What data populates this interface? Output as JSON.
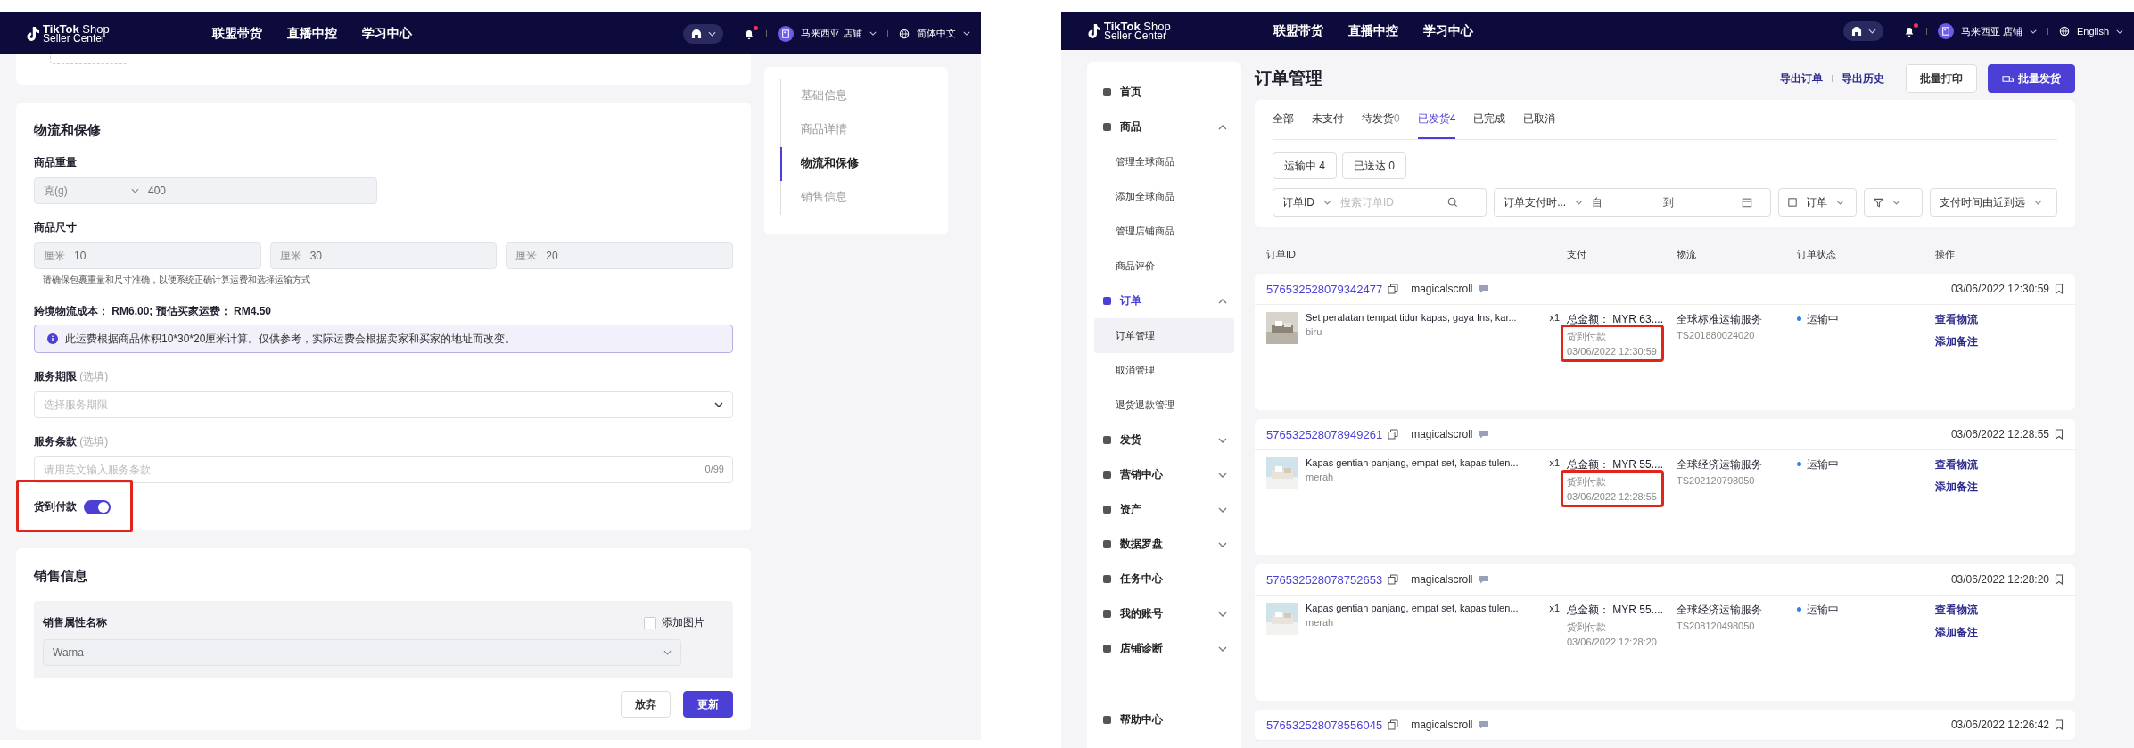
{
  "editor": {
    "nav": {
      "brand": "**TikTok** Shop",
      "brand_sub": "Seller Center",
      "links": [
        "联盟带货",
        "直播中控",
        "学习中心"
      ],
      "has_notification": true,
      "shop": "马来西亚 店铺",
      "language": "简体中文"
    },
    "logistics": {
      "title": "物流和保修",
      "weight": {
        "label": "商品重量",
        "unit": "克(g)",
        "value": "400"
      },
      "size": {
        "label": "商品尺寸",
        "fields": [
          {
            "unit": "厘米",
            "value": "10"
          },
          {
            "unit": "厘米",
            "value": "30"
          },
          {
            "unit": "厘米",
            "value": "20"
          }
        ],
        "hint": "请确保包裹重量和尺寸准确，以便系统正确计算运费和选择运输方式"
      },
      "cost": "跨境物流成本： RM6.00; 预估买家运费： RM4.50",
      "info": "此运费根据商品体积10*30*20厘米计算。仅供参考，实际运费会根据卖家和买家的地址而改变。",
      "service_period": {
        "label": "服务期限",
        "optional": "(选填)",
        "placeholder": "选择服务期限"
      },
      "service_terms": {
        "label": "服务条款",
        "optional": "(选填)",
        "placeholder": "请用英文输入服务条款",
        "counter": "0/99"
      },
      "cod": {
        "label": "货到付款",
        "on": true,
        "highlighted": true
      }
    },
    "sales": {
      "title": "销售信息",
      "attr_label": "销售属性名称",
      "add_image": {
        "label": "添加图片",
        "checked": false
      },
      "attr_value": "Warna",
      "discard": "放弃",
      "update": "更新"
    },
    "anchors": [
      {
        "label": "基础信息",
        "selected": false
      },
      {
        "label": "商品详情",
        "selected": false
      },
      {
        "label": "物流和保修",
        "selected": true
      },
      {
        "label": "销售信息",
        "selected": false
      }
    ]
  },
  "orders": {
    "nav": {
      "brand": "**TikTok** Shop",
      "brand_sub": "Seller Center",
      "links": [
        "联盟带货",
        "直播中控",
        "学习中心"
      ],
      "has_notification": true,
      "shop": "马来西亚 店铺",
      "language": "English"
    },
    "sidebar": [
      {
        "label": "首页",
        "kind": "link",
        "selected": false
      },
      {
        "label": "商品",
        "kind": "group",
        "expanded": true,
        "selected": false,
        "children": [
          {
            "label": "管理全球商品",
            "selected": false
          },
          {
            "label": "添加全球商品",
            "selected": false
          },
          {
            "label": "管理店铺商品",
            "selected": false
          },
          {
            "label": "商品评价",
            "selected": false
          }
        ]
      },
      {
        "label": "订单",
        "kind": "group",
        "expanded": true,
        "selected": true,
        "children": [
          {
            "label": "订单管理",
            "selected": true
          },
          {
            "label": "取消管理",
            "selected": false
          },
          {
            "label": "退货退款管理",
            "selected": false
          }
        ]
      },
      {
        "label": "发货",
        "kind": "group",
        "expanded": false,
        "selected": false
      },
      {
        "label": "营销中心",
        "kind": "group",
        "expanded": false,
        "selected": false
      },
      {
        "label": "资产",
        "kind": "group",
        "expanded": false,
        "selected": false
      },
      {
        "label": "数据罗盘",
        "kind": "group",
        "expanded": false,
        "selected": false
      },
      {
        "label": "任务中心",
        "kind": "link",
        "selected": false
      },
      {
        "label": "我的账号",
        "kind": "group",
        "expanded": false,
        "selected": false
      },
      {
        "label": "店铺诊断",
        "kind": "group",
        "expanded": false,
        "selected": false
      },
      {
        "label": "帮助中心",
        "kind": "link",
        "selected": false
      }
    ],
    "title": "订单管理",
    "export": "导出订单",
    "history": "导出历史",
    "print": "批量打印",
    "ship": "批量发货",
    "tabs": [
      {
        "label": "全部",
        "selected": false
      },
      {
        "label": "未支付",
        "selected": false
      },
      {
        "label": "待发货",
        "count": "0",
        "selected": false
      },
      {
        "label": "已发货",
        "count": "4",
        "selected": true
      },
      {
        "label": "已完成",
        "selected": false
      },
      {
        "label": "已取消",
        "selected": false
      }
    ],
    "chips": [
      "运输中 4",
      "已送达 0"
    ],
    "filters": {
      "id_type": "订单ID",
      "search_placeholder": "搜索订单ID",
      "date_type": "订单支付时...",
      "from": "自",
      "to": "到",
      "order_type": "订单",
      "sort": "支付时间由近到远"
    },
    "columns": [
      "订单ID",
      "支付",
      "物流",
      "订单状态",
      "操作"
    ],
    "list": [
      {
        "id": "576532528079342477",
        "buyer": "magicalscroll",
        "time": "03/06/2022 12:30:59",
        "product": "Set peralatan tempat tidur kapas, gaya Ins, kar...",
        "qty": "x1",
        "variant": "biru",
        "total_label": "总金额：",
        "total": "MYR 63....",
        "method": "货到付款",
        "paid_at": "03/06/2022 12:30:59",
        "shipping": "全球标准运输服务",
        "tracking": "TS201880024020",
        "status": "运输中",
        "color": "#2f80ed",
        "actions": [
          "查看物流",
          "添加备注"
        ],
        "highlighted": true
      },
      {
        "id": "576532528078949261",
        "buyer": "magicalscroll",
        "time": "03/06/2022 12:28:55",
        "product": "Kapas gentian panjang, empat set, kapas tulen...",
        "qty": "x1",
        "variant": "merah",
        "total_label": "总金额：",
        "total": "MYR 55....",
        "method": "货到付款",
        "paid_at": "03/06/2022 12:28:55",
        "shipping": "全球经济运输服务",
        "tracking": "TS202120798050",
        "status": "运输中",
        "color": "#2f80ed",
        "actions": [
          "查看物流",
          "添加备注"
        ],
        "highlighted": true
      },
      {
        "id": "576532528078752653",
        "buyer": "magicalscroll",
        "time": "03/06/2022 12:28:20",
        "product": "Kapas gentian panjang, empat set, kapas tulen...",
        "qty": "x1",
        "variant": "merah",
        "total_label": "总金额：",
        "total": "MYR 55....",
        "method": "货到付款",
        "paid_at": "03/06/2022 12:28:20",
        "shipping": "全球经济运输服务",
        "tracking": "TS208120498050",
        "status": "运输中",
        "color": "#2f80ed",
        "actions": [
          "查看物流",
          "添加备注"
        ],
        "highlighted": false
      },
      {
        "id": "576532528078556045",
        "buyer": "magicalscroll",
        "time": "03/06/2022 12:26:42"
      }
    ]
  }
}
